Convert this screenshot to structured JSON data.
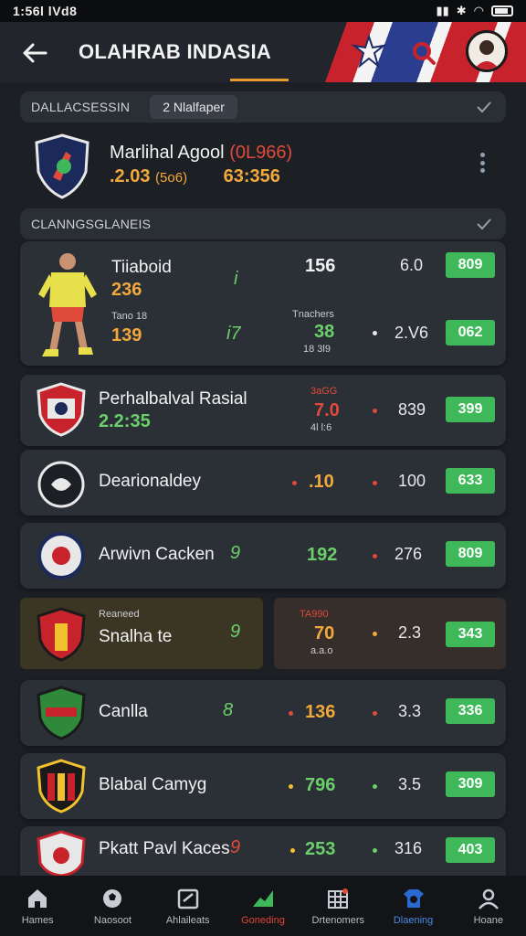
{
  "status": {
    "time": "1:56l lVd8"
  },
  "header": {
    "title": "OLAHRAB INDASIA"
  },
  "section1": {
    "label": "DALLACSESSIN",
    "chip": "2 Nlalfaper"
  },
  "live_match": {
    "name": "Marlihal Agool",
    "name_score": "(0L966)",
    "sub_left": ".2.03",
    "sub_odd": "(5o6)",
    "sub_right": "63:356"
  },
  "section2": {
    "label": "CLANNGSGLANEIS"
  },
  "featured": {
    "team": "Tiiaboid",
    "score": "236",
    "sub_label": "Tano 18",
    "sub_score": "139",
    "c1_top": "i",
    "c1_bottom": "i7",
    "c2_top": "156",
    "c2_label": "Tnachers",
    "c2_mid": "38",
    "c2_small": "18 3l9",
    "c3_top": "6.0",
    "c3_bottom": "2.V6",
    "pill_top": "809",
    "pill_bottom": "062"
  },
  "matches": [
    {
      "team": "Perhalbalval Rasial",
      "score": "2.2:35",
      "c2_label": "3aGG",
      "c2": "7.0",
      "c2_small": "4l l:6",
      "c3": "839",
      "odds": "399"
    },
    {
      "team": "Dearionaldey",
      "c2": ".10",
      "c3": "100",
      "odds": "633"
    },
    {
      "team": "Arwivn Cacken",
      "c1": "9",
      "c2": "192",
      "c3": "276",
      "odds": "809"
    },
    {
      "team": "Snalha te",
      "label": "Reaneed",
      "c1": "9",
      "c2_label": "TA990",
      "c2": "70",
      "c2_small": "a.a.o",
      "c3": "2.3",
      "odds": "343"
    },
    {
      "team": "Canlla",
      "c1": "8",
      "c2": "136",
      "c3": "3.3",
      "odds": "336"
    },
    {
      "team": "Blabal Camyg",
      "c2": "796",
      "c3": "3.5",
      "odds": "309"
    },
    {
      "team": "Pkatt Pavl Kaces",
      "c1": "9",
      "c2": "253",
      "c3": "316",
      "odds": "403"
    }
  ],
  "nav": [
    {
      "label": "Hames",
      "icon": "home-icon"
    },
    {
      "label": "Naosoot",
      "icon": "ball-icon"
    },
    {
      "label": "Ahlaileats",
      "icon": "calendar-icon"
    },
    {
      "label": "Goneding",
      "icon": "trend-icon"
    },
    {
      "label": "Drtenomers",
      "icon": "grid-icon"
    },
    {
      "label": "Dlaening",
      "icon": "shirt-icon"
    },
    {
      "label": "Hoane",
      "icon": "profile-icon"
    }
  ],
  "colors": {
    "accent_green": "#3fb85a",
    "accent_orange": "#f2a93c",
    "accent_red": "#e04a3a",
    "accent_blue": "#4a8ae0"
  }
}
